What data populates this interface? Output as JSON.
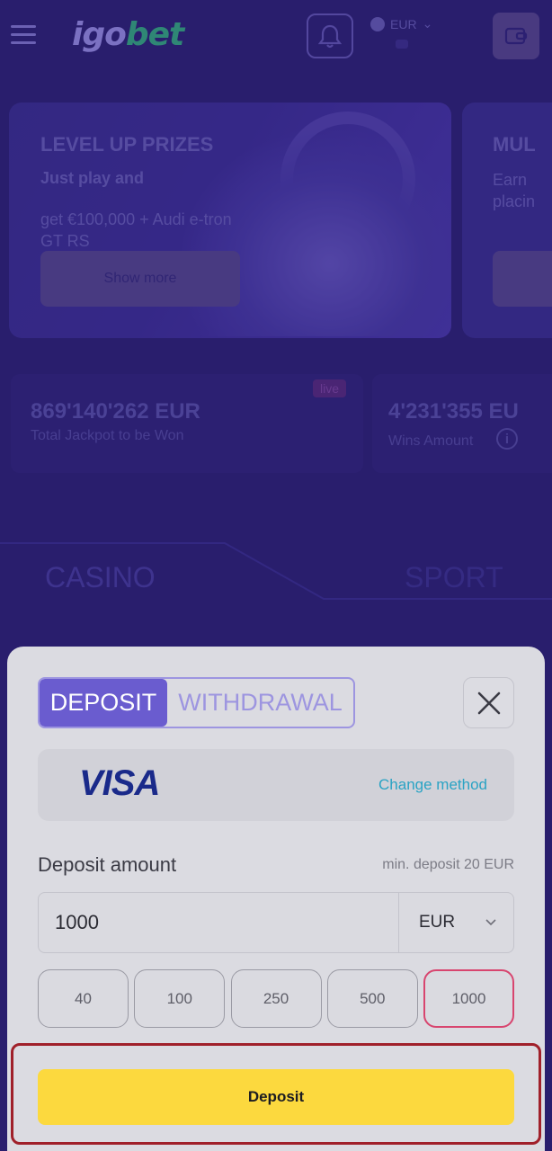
{
  "header": {
    "logo_part1": "igo",
    "logo_part2": "bet",
    "currency": "EUR"
  },
  "promos": [
    {
      "title": "LEVEL UP PRIZES",
      "subtitle": "Just play and",
      "description": "get €100,000 + Audi e-tron GT RS",
      "button_label": "Show more"
    },
    {
      "title": "MUL",
      "description_line1": "Earn",
      "description_line2": "placin"
    }
  ],
  "jackpot": {
    "value": "869'140'262 EUR",
    "label": "Total Jackpot to be Won",
    "badge": "live"
  },
  "wins": {
    "value": "4'231'355 EU",
    "label": "Wins Amount",
    "info_glyph": "i"
  },
  "nav_tabs": {
    "casino": "CASINO",
    "sport": "SPORT"
  },
  "sheet": {
    "tabs": {
      "deposit": "DEPOSIT",
      "withdrawal": "WITHDRAWAL"
    },
    "method": {
      "logo_text": "VISA",
      "change_label": "Change method"
    },
    "amount_label": "Deposit amount",
    "min_deposit": "min. deposit 20 EUR",
    "amount_value": "1000",
    "currency": "EUR",
    "quick_amounts": [
      "40",
      "100",
      "250",
      "500",
      "1000"
    ],
    "selected_quick_amount": "1000",
    "deposit_button_label": "Deposit"
  },
  "colors": {
    "accent_purple": "#6a5ccf",
    "deposit_yellow": "#fcd93e",
    "link_teal": "#2aa3c4",
    "selected_pink": "#d8456f",
    "highlight_red": "#a0202a"
  }
}
